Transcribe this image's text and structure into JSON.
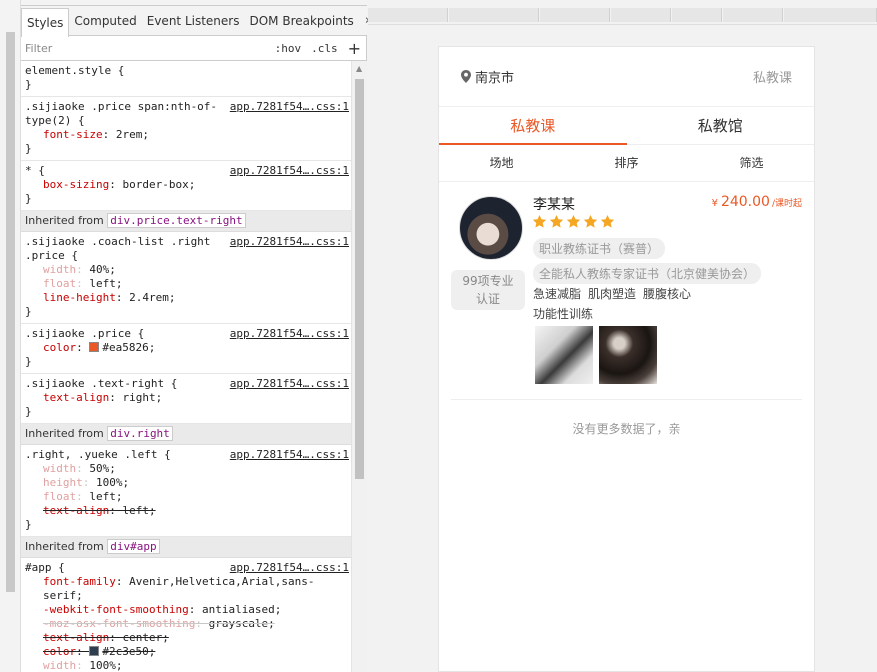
{
  "devtools": {
    "tabs": [
      "Styles",
      "Computed",
      "Event Listeners",
      "DOM Breakpoints"
    ],
    "more": "»",
    "filter_placeholder": "Filter",
    "hov": ":hov",
    "cls": ".cls",
    "plus": "+",
    "rules": [
      {
        "selector": "element.style {",
        "source": "",
        "decls": [],
        "close": "}"
      },
      {
        "selector": ".sijiaoke .price span:nth-of-type(2) {",
        "source": "app.7281f54….css:1",
        "decls": [
          {
            "p": "font-size",
            "v": "2rem;",
            "state": "normal"
          }
        ],
        "close": "}"
      },
      {
        "selector": "* {",
        "source": "app.7281f54….css:1",
        "decls": [
          {
            "p": "box-sizing",
            "v": "border-box;",
            "state": "normal"
          }
        ],
        "close": "}"
      }
    ],
    "inherited_1": {
      "label": "Inherited from",
      "tag": "div.price.text-right"
    },
    "rules_2": [
      {
        "selector": ".sijiaoke .coach-list .right .price {",
        "source": "app.7281f54….css:1",
        "decls": [
          {
            "p": "width",
            "v": "40%;",
            "state": "overridden"
          },
          {
            "p": "float",
            "v": "left;",
            "state": "overridden"
          },
          {
            "p": "line-height",
            "v": "2.4rem;",
            "state": "normal"
          }
        ],
        "close": "}"
      },
      {
        "selector": ".sijiaoke .price {",
        "source": "app.7281f54….css:1",
        "decls": [
          {
            "p": "color",
            "v": "#ea5826;",
            "state": "color",
            "swatch": "#ea5826"
          }
        ],
        "close": "}"
      },
      {
        "selector": ".sijiaoke .text-right {",
        "source": "app.7281f54….css:1",
        "decls": [
          {
            "p": "text-align",
            "v": "right;",
            "state": "normal"
          }
        ],
        "close": "}"
      }
    ],
    "inherited_2": {
      "label": "Inherited from",
      "tag": "div.right"
    },
    "rules_3": [
      {
        "selector": ".right, .yueke .left {",
        "source": "app.7281f54….css:1",
        "decls": [
          {
            "p": "width",
            "v": "50%;",
            "state": "overridden"
          },
          {
            "p": "height",
            "v": "100%;",
            "state": "overridden"
          },
          {
            "p": "float",
            "v": "left;",
            "state": "overridden"
          },
          {
            "p": "text-align",
            "v": "left;",
            "state": "strike"
          }
        ],
        "close": "}"
      }
    ],
    "inherited_3": {
      "label": "Inherited from",
      "tag": "div#app"
    },
    "rules_4": [
      {
        "selector": "#app {",
        "source": "app.7281f54….css:1",
        "decls": [
          {
            "p": "font-family",
            "v": "Avenir,Helvetica,Arial,sans-serif;",
            "state": "normal"
          },
          {
            "p": "-webkit-font-smoothing",
            "v": "antialiased;",
            "state": "normal"
          },
          {
            "p": "-moz-osx-font-smoothing",
            "v": "grayscale;",
            "state": "strike-gray"
          },
          {
            "p": "text-align",
            "v": "center;",
            "state": "strike"
          },
          {
            "p": "color",
            "v": "#2c3e50;",
            "state": "strike-color",
            "swatch": "#2c3e50"
          },
          {
            "p": "width",
            "v": "100%;",
            "state": "overridden"
          }
        ],
        "close": ""
      }
    ]
  },
  "app": {
    "city": "南京市",
    "header_right": "私教课",
    "tabs": [
      "私教课",
      "私教馆"
    ],
    "filters": [
      "场地",
      "排序",
      "筛选"
    ],
    "coach": {
      "name": "李某某",
      "price_currency": "¥",
      "price": "240.00",
      "price_unit": "/课时起",
      "rating": 5,
      "cert_1": "职业教练证书（赛普）",
      "auth_badge_line1": "99项专业",
      "auth_badge_line2": "认证",
      "cert_2": "全能私人教练专家证书（北京健美协会）",
      "tags": [
        "急速减脂",
        "肌肉塑造",
        "腰腹核心",
        "功能性训练"
      ]
    },
    "no_more": "没有更多数据了，亲"
  },
  "colors": {
    "accent": "#ea5826",
    "star": "#f5a623"
  }
}
